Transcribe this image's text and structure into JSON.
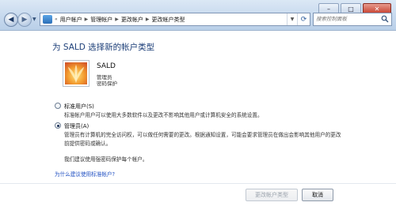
{
  "breadcrumbs": [
    "用户帐户",
    "管理帐户",
    "更改帐户",
    "更改帐户类型"
  ],
  "search": {
    "placeholder": "搜索控制面板"
  },
  "page": {
    "title": "为 SALD 选择新的帐户类型",
    "account": {
      "name": "SALD",
      "role": "管理员",
      "password_status": "密码保护"
    },
    "options": [
      {
        "label": "标准用户(S)",
        "selected": false,
        "description": "标准帐户用户可以使用大多数软件以及更改不影响其他用户或计算机安全的系统设置。"
      },
      {
        "label": "管理员(A)",
        "selected": true,
        "description": "管理员有计算机的完全访问权，可以做任何需要的更改。根据通知设置，可能会要求管理员在做出会影响其他用户的更改前提供密码或确认。"
      }
    ],
    "recommendation": "我们建议使用强密码保护每个帐户。",
    "why_link": "为什么建议使用标准帐户?"
  },
  "buttons": {
    "change_type": "更改帐户类型",
    "cancel": "取消"
  },
  "window_controls": {
    "minimize": "–",
    "maximize": "□",
    "close": "✕"
  },
  "colors": {
    "title": "#1c3e78",
    "link": "#1f4fc2",
    "accent": "#2b6fb8"
  },
  "icons": {
    "back": "back-arrow-icon",
    "forward": "forward-arrow-icon",
    "search": "search-icon",
    "refresh": "refresh-icon",
    "control_panel": "control-panel-icon"
  }
}
